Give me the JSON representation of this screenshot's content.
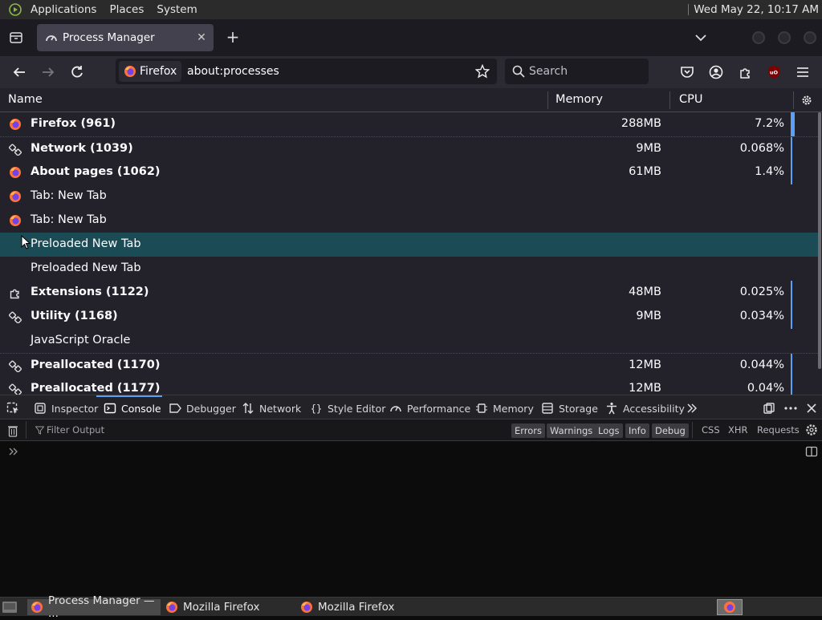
{
  "top_panel": {
    "menus": [
      "Applications",
      "Places",
      "System"
    ],
    "clock": "Wed May 22, 10:17 AM"
  },
  "tabs": [
    {
      "title": "Process Manager",
      "active": true
    }
  ],
  "navbar": {
    "identity_label": "Firefox",
    "url": "about:processes",
    "search_placeholder": "Search"
  },
  "table": {
    "columns": [
      "Name",
      "Memory",
      "CPU"
    ],
    "rows": [
      {
        "icon": "firefox-icon",
        "name": "Firefox (961)",
        "bold": true,
        "memory": "288MB",
        "cpu": "7.2%",
        "cpu_fraction": 0.072
      },
      {
        "icon": "plugin-icon",
        "name": "Network (1039)",
        "bold": true,
        "memory": "9MB",
        "cpu": "0.068%",
        "cpu_fraction": 0.00068
      },
      {
        "icon": "firefox-icon",
        "name": "About pages (1062)",
        "bold": true,
        "memory": "61MB",
        "cpu": "1.4%",
        "cpu_fraction": 0.014
      },
      {
        "icon": "firefox-icon",
        "name": "Tab: New Tab",
        "bold": false,
        "memory": "",
        "cpu": ""
      },
      {
        "icon": "firefox-icon",
        "name": "Tab: New Tab",
        "bold": false,
        "memory": "",
        "cpu": ""
      },
      {
        "icon": "",
        "name": "Preloaded New Tab",
        "bold": false,
        "memory": "",
        "cpu": "",
        "selected": true
      },
      {
        "icon": "",
        "name": "Preloaded New Tab",
        "bold": false,
        "memory": "",
        "cpu": ""
      },
      {
        "icon": "puzzle-icon",
        "name": "Extensions (1122)",
        "bold": true,
        "memory": "48MB",
        "cpu": "0.025%",
        "cpu_fraction": 0.00025
      },
      {
        "icon": "plugin-icon",
        "name": "Utility (1168)",
        "bold": true,
        "memory": "9MB",
        "cpu": "0.034%",
        "cpu_fraction": 0.00034
      },
      {
        "icon": "",
        "name": "JavaScript Oracle",
        "bold": false,
        "memory": "",
        "cpu": ""
      },
      {
        "icon": "plugin-icon",
        "name": "Preallocated (1170)",
        "bold": true,
        "memory": "12MB",
        "cpu": "0.044%",
        "cpu_fraction": 0.00044
      },
      {
        "icon": "plugin-icon",
        "name": "Preallocated (1177)",
        "bold": true,
        "memory": "12MB",
        "cpu": "0.04%",
        "cpu_fraction": 0.0004
      }
    ]
  },
  "devtools": {
    "tabs": [
      "Inspector",
      "Console",
      "Debugger",
      "Network",
      "Style Editor",
      "Performance",
      "Memory",
      "Storage",
      "Accessibility"
    ],
    "active_tab": "Console",
    "filter_placeholder": "Filter Output",
    "filter_buttons": [
      "Errors",
      "Warnings",
      "Logs",
      "Info",
      "Debug"
    ],
    "filter_plain": [
      "CSS",
      "XHR",
      "Requests"
    ]
  },
  "taskbar": {
    "tasks": [
      "Process Manager — ...",
      "Mozilla Firefox",
      "Mozilla Firefox"
    ]
  },
  "colors": {
    "accent": "#5aa0f5",
    "selected_row": "#1b4b55"
  }
}
